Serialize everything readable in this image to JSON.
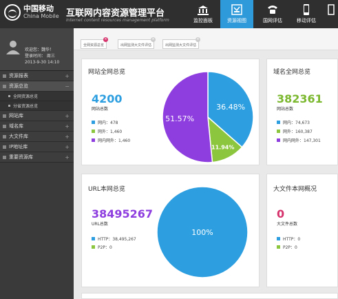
{
  "header": {
    "logo_cn": "中国移动",
    "logo_en": "China Mobile",
    "title": "互联网内容资源管理平台",
    "subtitle": "Internet content resources management platform",
    "nav": [
      {
        "label": "监控面板",
        "icon": "monitor-icon"
      },
      {
        "label": "资源视图",
        "icon": "resource-view-icon",
        "active": true
      },
      {
        "label": "国网评估",
        "icon": "phone-icon"
      },
      {
        "label": "移动评估",
        "icon": "mobile-icon"
      },
      {
        "label": "",
        "icon": "more-icon"
      }
    ]
  },
  "user": {
    "welcome": "欢迎您：魏华！",
    "login_label": "登录时间：  周三",
    "login_time": "2013-9-30   14:10"
  },
  "sidebar": {
    "items": [
      {
        "label": "资源报表"
      },
      {
        "label": "资源总览"
      },
      {
        "label": "全网资源总览",
        "sub": true
      },
      {
        "label": "分省资源总览",
        "sub": true
      },
      {
        "label": "网站库"
      },
      {
        "label": "域名库"
      },
      {
        "label": "大文件库"
      },
      {
        "label": "IP地址库"
      },
      {
        "label": "重要资源库"
      }
    ]
  },
  "tabs": [
    {
      "label": "全网资源总览",
      "active": true
    },
    {
      "label": "出网监测大文件评估"
    },
    {
      "label": "出网监测大文件评估"
    }
  ],
  "cards": {
    "site": {
      "title": "网站全网总览",
      "count": "4200",
      "count_label": "网站总数",
      "legend": [
        "网内：478",
        "网外：1,460",
        "网内网外：1,460"
      ],
      "slices": [
        "36.48%",
        "11.94%",
        "51.57%"
      ]
    },
    "domain": {
      "title": "域名全网总览",
      "count": "382361",
      "count_label": "网站总数",
      "legend": [
        "网内：74,673",
        "网外：160,387",
        "网内网外：147,301"
      ]
    },
    "url": {
      "title": "URL本网总览",
      "count": "38495267",
      "count_label": "URL总数",
      "legend": [
        "HTTP：38,495,267",
        "P2P：0"
      ],
      "slices": [
        "100%"
      ]
    },
    "bigfile": {
      "title": "大文件本网概况",
      "count": "0",
      "count_label": "大文件总数",
      "legend": [
        "HTTP：0",
        "P2P：0"
      ]
    }
  },
  "colors": {
    "blue": "#2d9fe0",
    "green": "#8cc63e",
    "purple": "#8e3ddf",
    "topbar": "#2f2f2f",
    "domain_green": "#7cb82f",
    "pink": "#d6336c"
  },
  "chart_data": [
    {
      "type": "pie",
      "title": "网站全网总览",
      "categories": [
        "网内",
        "网外",
        "网内网外"
      ],
      "values": [
        36.48,
        11.94,
        51.57
      ],
      "labels": [
        "36.48%",
        "11.94%",
        "51.57%"
      ]
    },
    {
      "type": "pie",
      "title": "URL本网总览",
      "categories": [
        "HTTP",
        "P2P"
      ],
      "values": [
        100,
        0
      ],
      "labels": [
        "100%"
      ]
    }
  ]
}
